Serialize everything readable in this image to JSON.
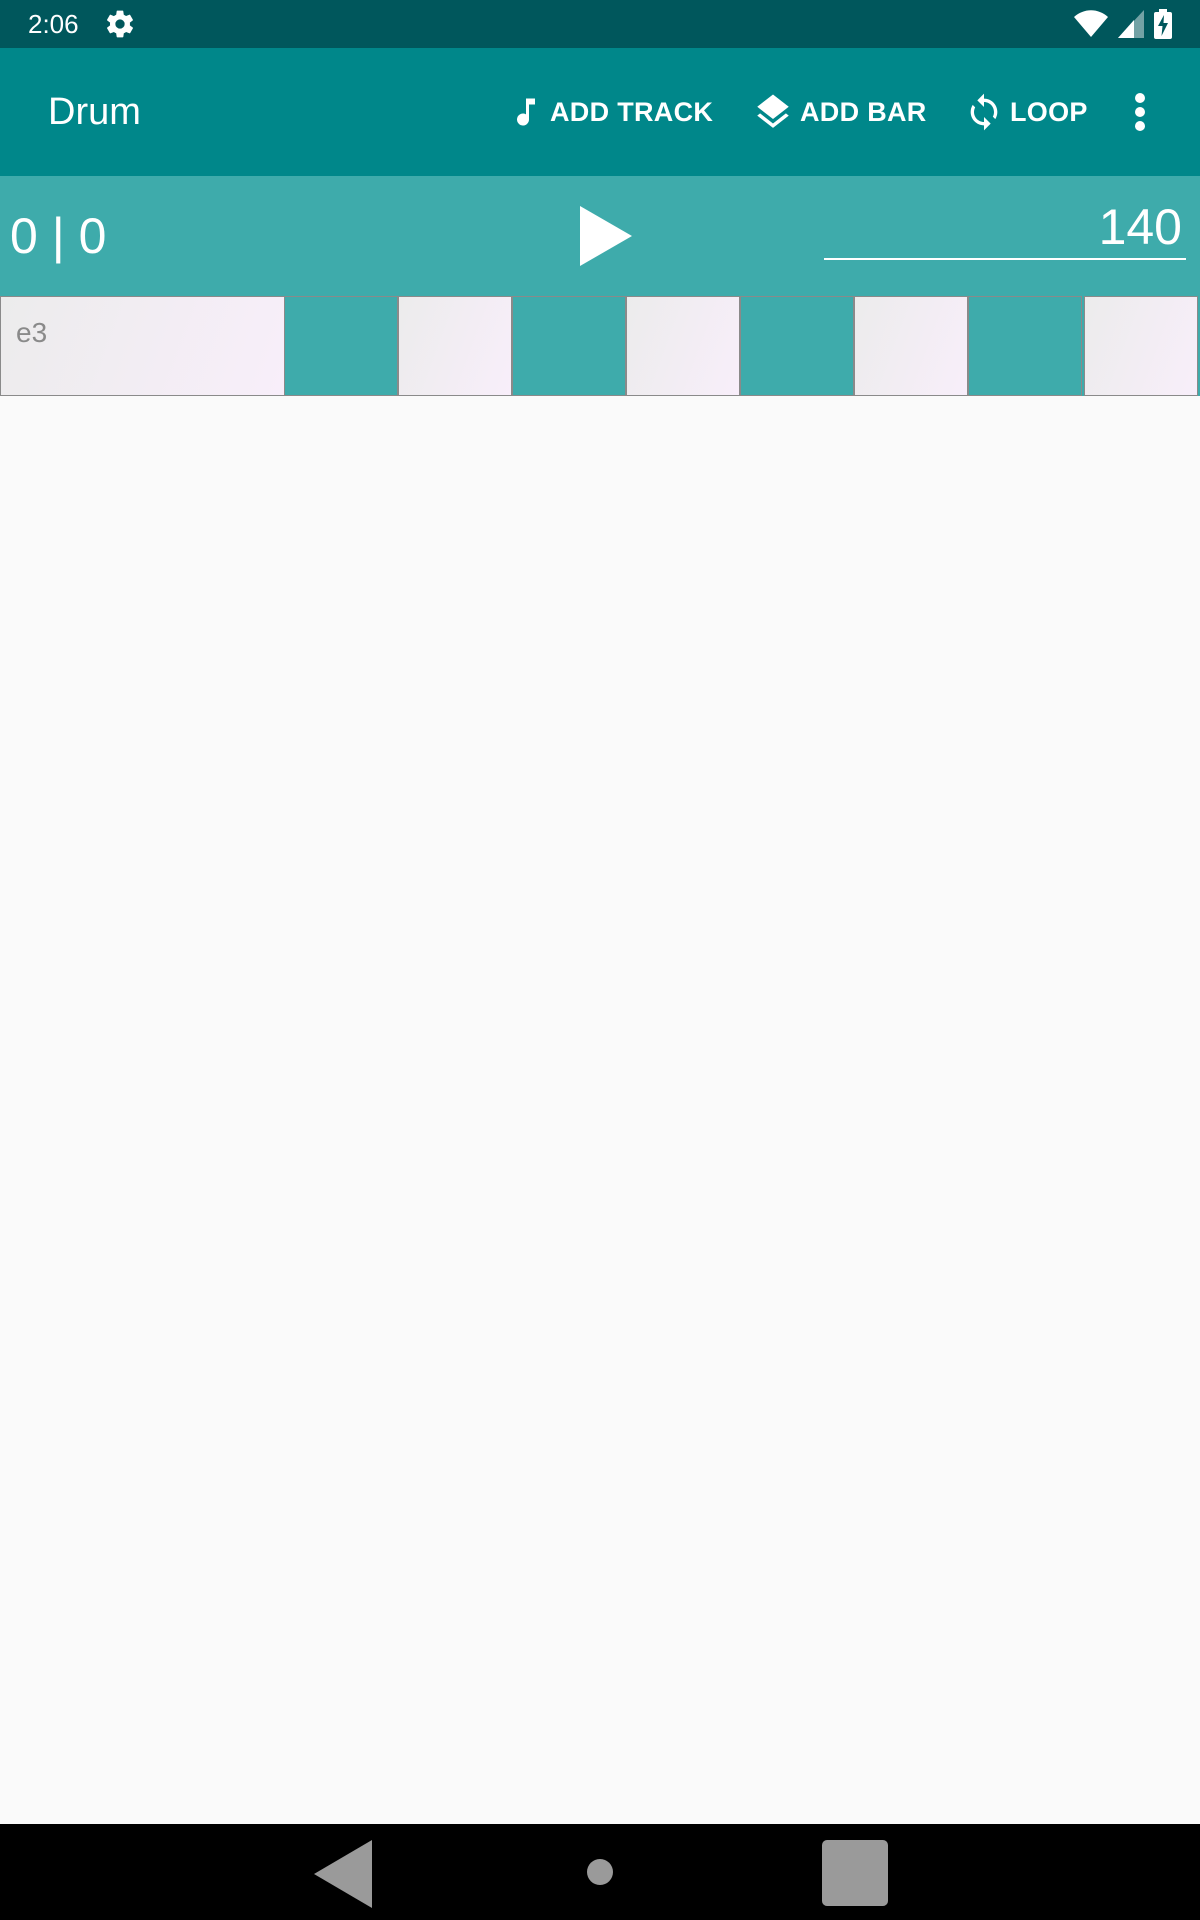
{
  "status_bar": {
    "time": "2:06",
    "icons": [
      "gear-icon",
      "wifi-icon",
      "signal-icon",
      "battery-charging-icon"
    ]
  },
  "app_bar": {
    "title": "Drum",
    "actions": [
      {
        "label": "ADD TRACK",
        "icon": "music-note-icon"
      },
      {
        "label": "ADD BAR",
        "icon": "layers-icon"
      },
      {
        "label": "LOOP",
        "icon": "loop-icon"
      }
    ],
    "overflow_icon": "more-vert-icon"
  },
  "transport": {
    "position": "0 | 0",
    "play_icon": "play-icon",
    "tempo": "140"
  },
  "track": {
    "name": "e3",
    "steps": [
      false,
      true,
      false,
      true,
      false,
      true,
      false,
      true
    ]
  },
  "nav_bar": {
    "icons": [
      "back-icon",
      "home-icon",
      "recents-icon"
    ]
  },
  "colors": {
    "status_bar": "#00575c",
    "app_bar": "#00878a",
    "transport": "#3eabab",
    "background": "#fafafa",
    "nav_bar": "#000000"
  }
}
